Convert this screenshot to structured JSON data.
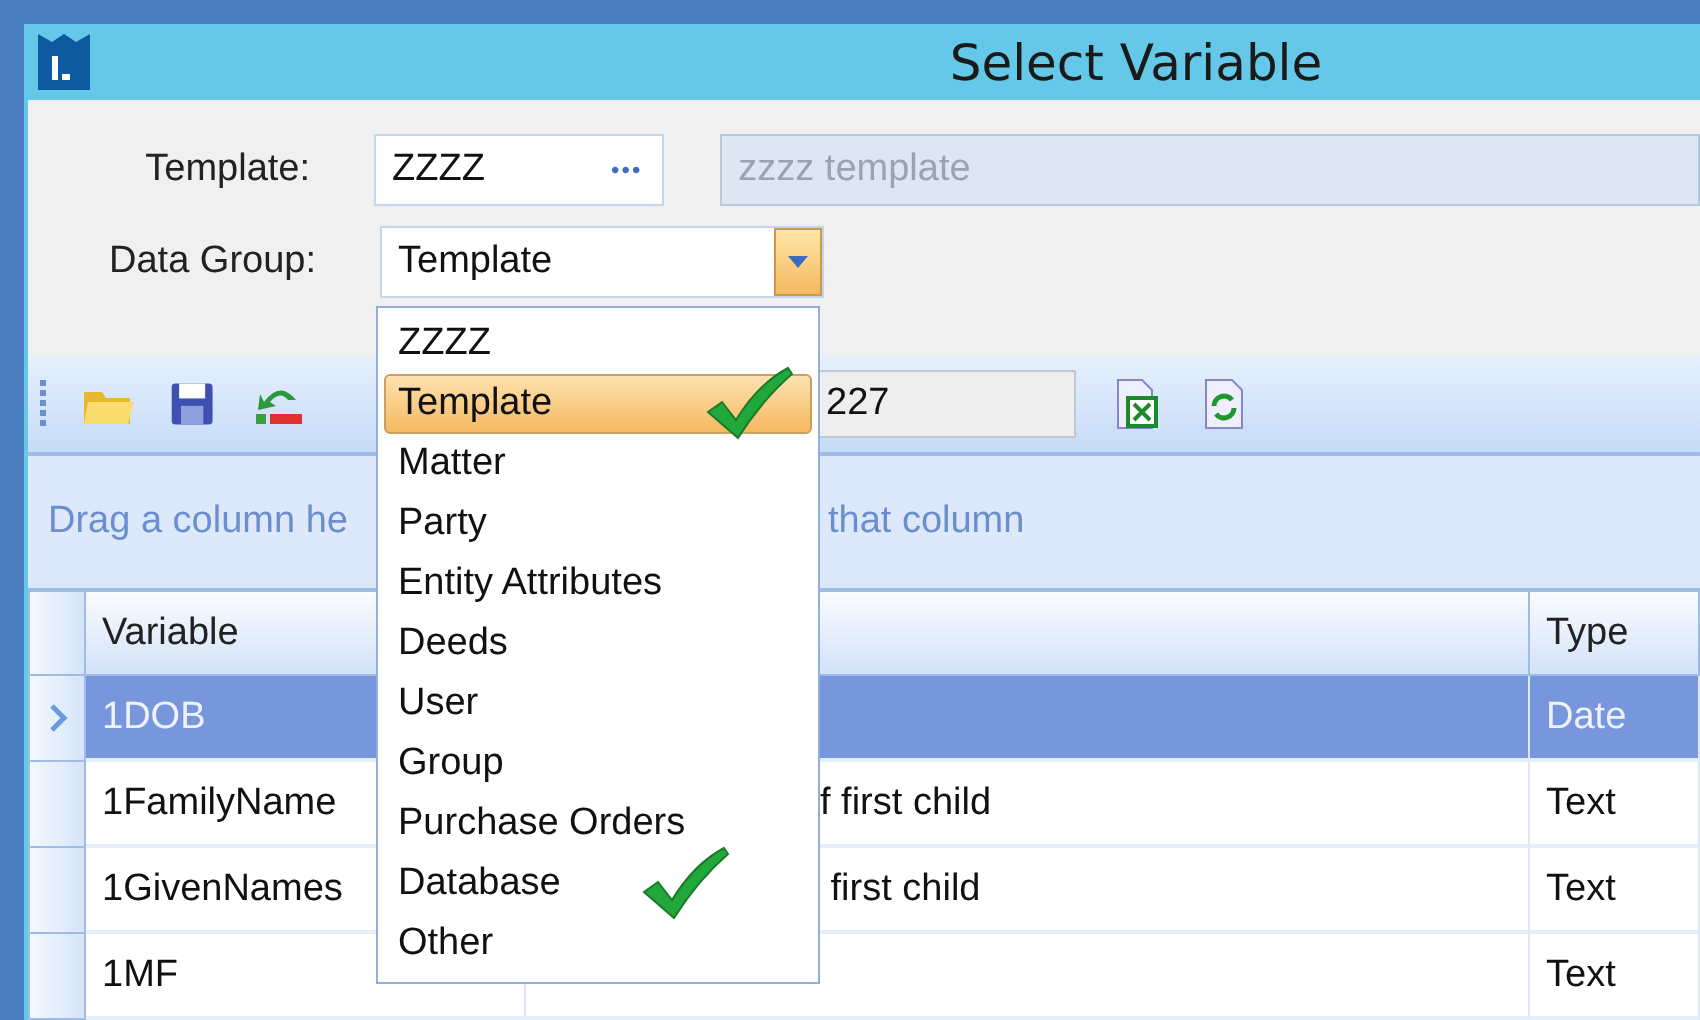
{
  "window": {
    "title": "Select Variable"
  },
  "form": {
    "template_label": "Template:",
    "template_value": "ZZZZ",
    "browse": "•••",
    "template_description": "zzzz template",
    "data_group_label": "Data Group:",
    "data_group_value": "Template"
  },
  "dropdown": {
    "open": true,
    "items": [
      {
        "label": "ZZZZ",
        "selected": false,
        "marked": false
      },
      {
        "label": "Template",
        "selected": true,
        "marked": true
      },
      {
        "label": "Matter",
        "selected": false,
        "marked": false
      },
      {
        "label": "Party",
        "selected": false,
        "marked": false
      },
      {
        "label": "Entity Attributes",
        "selected": false,
        "marked": false
      },
      {
        "label": "Deeds",
        "selected": false,
        "marked": false
      },
      {
        "label": "User",
        "selected": false,
        "marked": false
      },
      {
        "label": "Group",
        "selected": false,
        "marked": false
      },
      {
        "label": "Purchase Orders",
        "selected": false,
        "marked": false
      },
      {
        "label": "Database",
        "selected": false,
        "marked": true
      },
      {
        "label": "Other",
        "selected": false,
        "marked": false
      }
    ]
  },
  "toolbar": {
    "search_value": "227"
  },
  "group_panel": {
    "text_left": "Drag a column he",
    "text_right": "that column"
  },
  "table": {
    "columns": [
      "Variable",
      "",
      "Type"
    ],
    "rows": [
      {
        "variable": "1DOB",
        "description": "",
        "type": "Date",
        "selected": true
      },
      {
        "variable": "1FamilyName",
        "description": "f first child",
        "type": "Text",
        "selected": false
      },
      {
        "variable": "1GivenNames",
        "description": " first child",
        "type": "Text",
        "selected": false
      },
      {
        "variable": "1MF",
        "type": "Text",
        "selected": false
      }
    ]
  }
}
